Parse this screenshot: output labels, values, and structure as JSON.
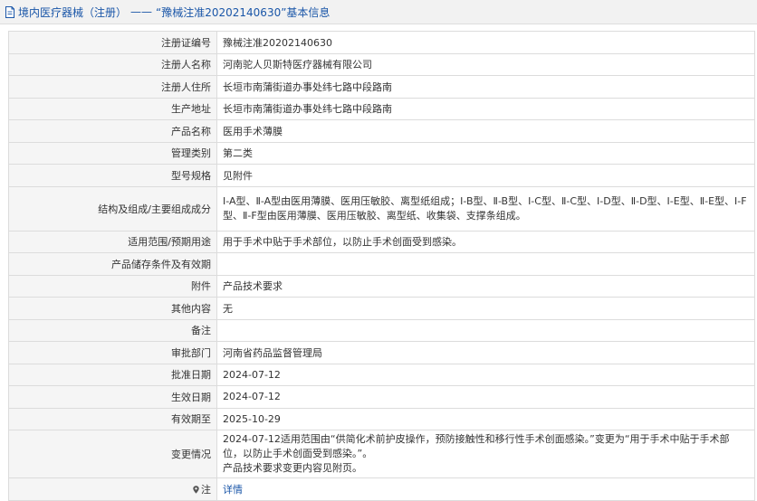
{
  "header": {
    "breadcrumb_section": "境内医疗器械（注册）",
    "separator": "——",
    "record_title": "“豫械注准20202140630”基本信息"
  },
  "fields": {
    "reg_no": {
      "label": "注册证编号",
      "value": "豫械注准20202140630"
    },
    "registrant": {
      "label": "注册人名称",
      "value": "河南驼人贝斯特医疗器械有限公司"
    },
    "residence": {
      "label": "注册人住所",
      "value": "长垣市南蒲街道办事处纬七路中段路南"
    },
    "production": {
      "label": "生产地址",
      "value": "长垣市南蒲街道办事处纬七路中段路南"
    },
    "product": {
      "label": "产品名称",
      "value": "医用手术薄膜"
    },
    "category": {
      "label": "管理类别",
      "value": "第二类"
    },
    "model": {
      "label": "型号规格",
      "value": "见附件"
    },
    "structure": {
      "label": "结构及组成/主要组成成分",
      "value": "Ⅰ-A型、Ⅱ-A型由医用薄膜、医用压敏胶、离型纸组成；Ⅰ-B型、Ⅱ-B型、Ⅰ-C型、Ⅱ-C型、Ⅰ-D型、Ⅱ-D型、Ⅰ-E型、Ⅱ-E型、Ⅰ-F型、Ⅱ-F型由医用薄膜、医用压敏胶、离型纸、收集袋、支撑条组成。"
    },
    "scope": {
      "label": "适用范围/预期用途",
      "value": "用于手术中贴于手术部位，以防止手术创面受到感染。"
    },
    "storage": {
      "label": "产品储存条件及有效期",
      "value": ""
    },
    "attachment": {
      "label": "附件",
      "value": "产品技术要求"
    },
    "other": {
      "label": "其他内容",
      "value": "无"
    },
    "remark": {
      "label": "备注",
      "value": ""
    },
    "approver": {
      "label": "审批部门",
      "value": "河南省药品监督管理局"
    },
    "approve_date": {
      "label": "批准日期",
      "value": "2024-07-12"
    },
    "effective": {
      "label": "生效日期",
      "value": "2024-07-12"
    },
    "expiry": {
      "label": "有效期至",
      "value": "2025-10-29"
    },
    "changes": {
      "label": "变更情况",
      "line1": "2024-07-12适用范围由“供简化术前护皮操作，预防接触性和移行性手术创面感染。”变更为“用于手术中贴于手术部位，以防止手术创面受到感染。”。",
      "line2": "产品技术要求变更内容见附页。"
    },
    "footer": {
      "label": "注",
      "link": "详情"
    }
  }
}
